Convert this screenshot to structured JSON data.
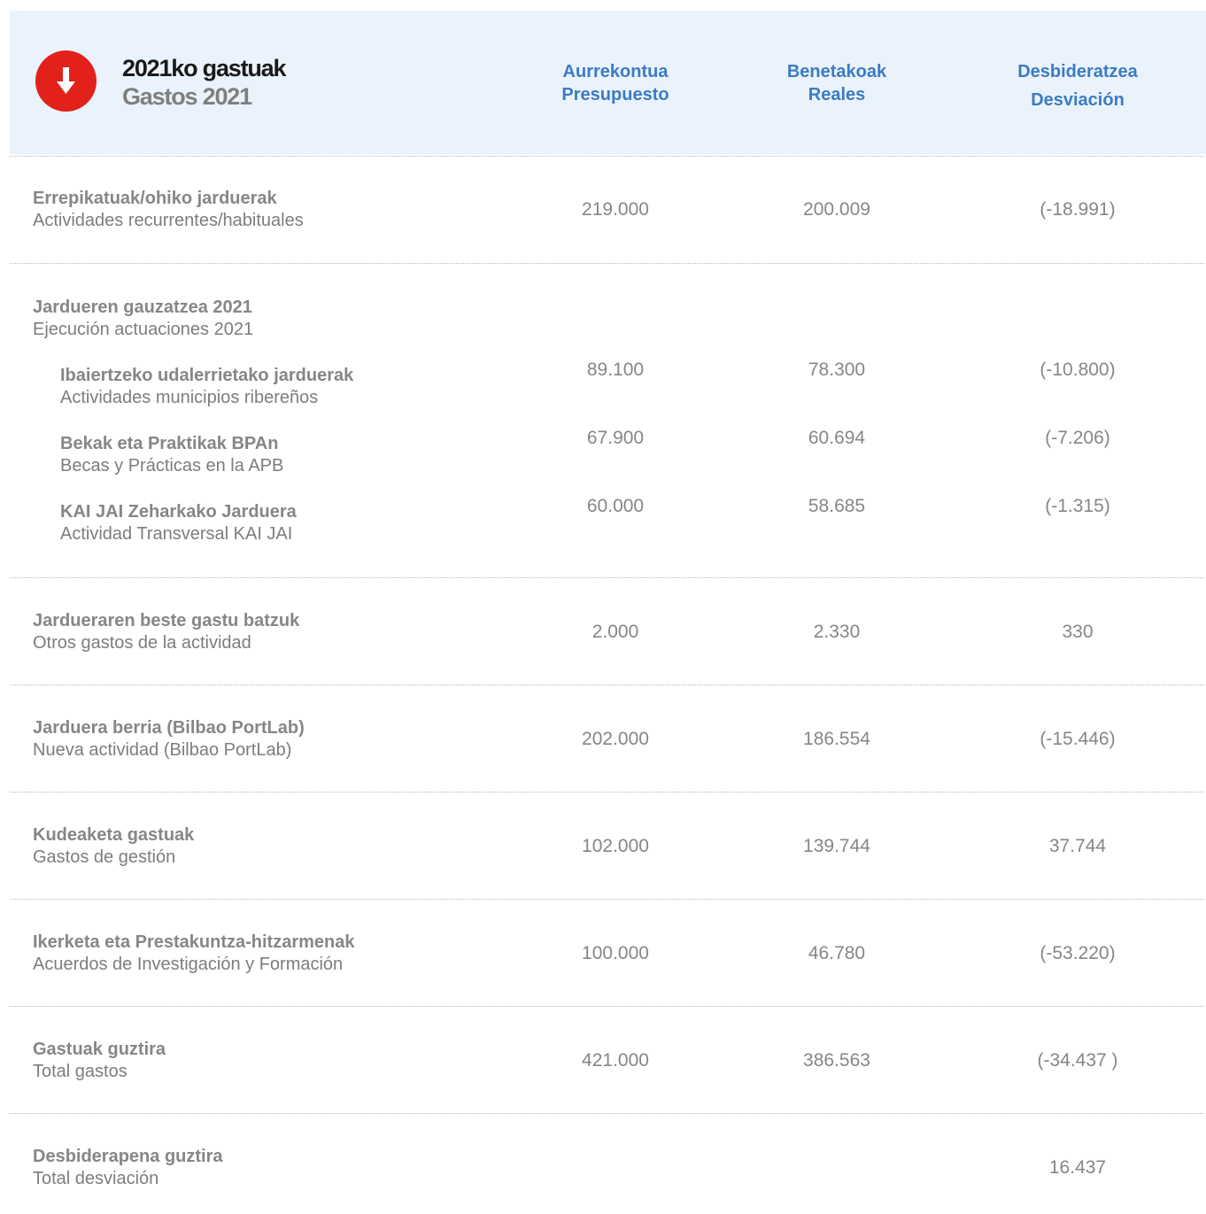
{
  "header": {
    "title_eu": "2021ko gastuak",
    "title_es": "Gastos 2021",
    "icon": "down-arrow-icon",
    "icon_color": "#e3211b",
    "accent_color": "#3b7bc4",
    "background_color": "#eaf3fb",
    "columns": [
      {
        "eu": "Aurrekontua",
        "es": "Presupuesto"
      },
      {
        "eu": "Benetakoak",
        "es": "Reales"
      },
      {
        "eu": "Desbideratzea",
        "es": "Desviación"
      }
    ]
  },
  "rows": {
    "r1": {
      "eu": "Errepikatuak/ohiko jarduerak",
      "es": "Actividades recurrentes/habituales",
      "budget": "219.000",
      "actual": "200.009",
      "deviation": "(-18.991)"
    },
    "r2": {
      "eu": "Jardueren gauzatzea 2021",
      "es": "Ejecución actuaciones 2021"
    },
    "r2a": {
      "eu": "Ibaiertzeko udalerrietako jarduerak",
      "es": "Actividades municipios ribereños",
      "budget": "89.100",
      "actual": "78.300",
      "deviation": "(-10.800)"
    },
    "r2b": {
      "eu": "Bekak eta Praktikak BPAn",
      "es": "Becas y Prácticas en la APB",
      "budget": "67.900",
      "actual": "60.694",
      "deviation": "(-7.206)"
    },
    "r2c": {
      "eu": "KAI JAI Zeharkako Jarduera",
      "es": "Actividad Transversal KAI JAI",
      "budget": "60.000",
      "actual": "58.685",
      "deviation": "(-1.315)"
    },
    "r3": {
      "eu": "Jardueraren beste gastu batzuk",
      "es": "Otros gastos de la actividad",
      "budget": "2.000",
      "actual": "2.330",
      "deviation": "330"
    },
    "r4": {
      "eu": "Jarduera berria (Bilbao PortLab)",
      "es": "Nueva actividad (Bilbao PortLab)",
      "budget": "202.000",
      "actual": "186.554",
      "deviation": "(-15.446)"
    },
    "r5": {
      "eu": "Kudeaketa gastuak",
      "es": "Gastos de gestión",
      "budget": "102.000",
      "actual": "139.744",
      "deviation": "37.744"
    },
    "r6": {
      "eu": "Ikerketa eta Prestakuntza-hitzarmenak",
      "es": "Acuerdos de Investigación y Formación",
      "budget": "100.000",
      "actual": "46.780",
      "deviation": "(-53.220)"
    },
    "r7": {
      "eu": "Gastuak guztira",
      "es": "Total gastos",
      "budget": "421.000",
      "actual": "386.563",
      "deviation": "(-34.437 )"
    },
    "r8": {
      "eu": "Desbiderapena guztira",
      "es": "Total desviación",
      "deviation": "16.437"
    }
  }
}
